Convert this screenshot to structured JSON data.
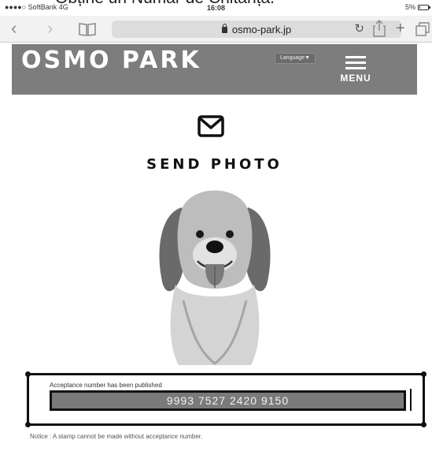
{
  "caption": {
    "text": "Obține un Număr de Chitanța."
  },
  "status_bar": {
    "carrier": "●●●●○ SoftBank 4G",
    "time": "16:08",
    "battery": "5%",
    "battery_level": 0.05
  },
  "browser": {
    "back_icon": "chevron-left",
    "forward_icon": "chevron-right",
    "bookmarks_icon": "book",
    "url": "osmo-park.jp",
    "reload_icon": "reload",
    "share_icon": "share",
    "new_tab_icon": "plus",
    "tabs_icon": "tabs"
  },
  "header": {
    "logo": "OSMO PARK",
    "language_button": "Language▼",
    "menu_label": "MENU"
  },
  "main": {
    "envelope_icon": "envelope",
    "title": "SEND PHOTO",
    "acceptance_label": "Acceptance number has been published",
    "acceptance_number": "9993 7527 2420 9150",
    "notice": "Notice : A stamp cannot be made without acceptance number."
  },
  "colors": {
    "header_bg": "#7d7d7d",
    "field_bg": "#7a7a7a",
    "highlight_border": "#111111"
  }
}
